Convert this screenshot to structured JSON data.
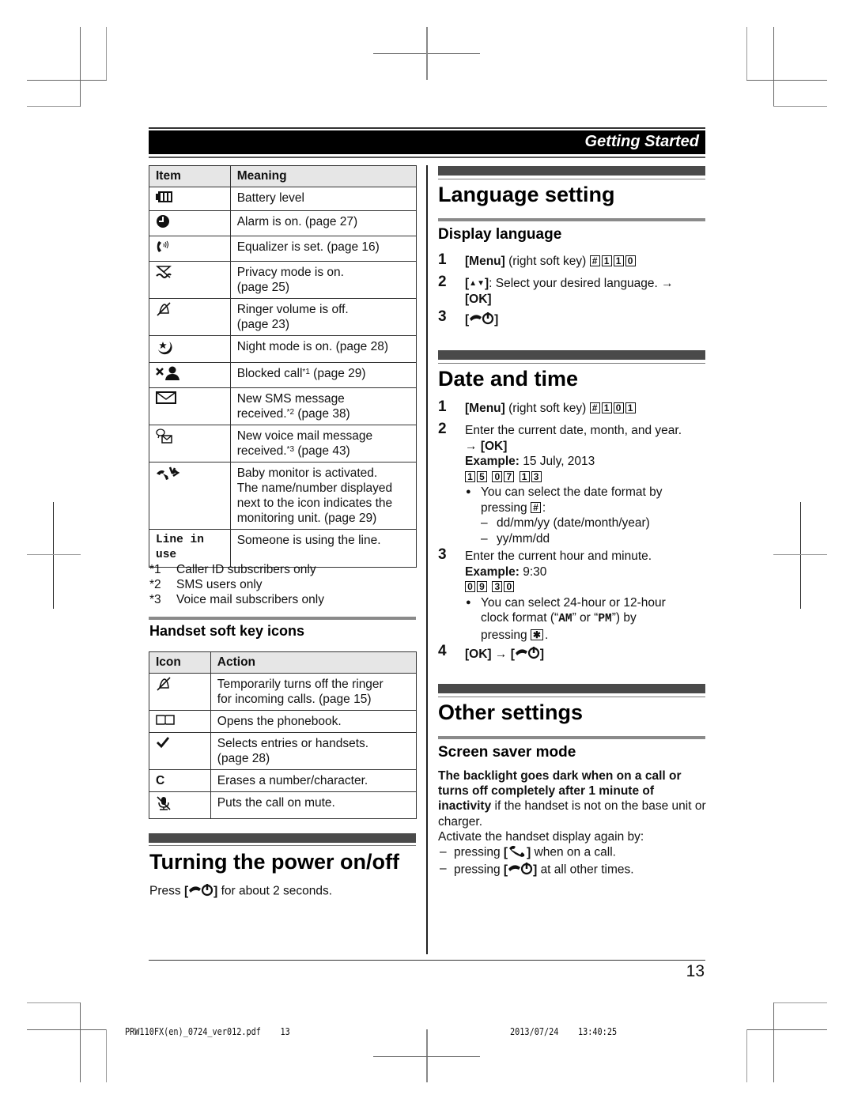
{
  "header": {
    "title": "Getting Started"
  },
  "display_icons_table": {
    "headers": [
      "Item",
      "Meaning"
    ],
    "rows": [
      {
        "icon": "battery-icon",
        "meaning": "Battery level"
      },
      {
        "icon": "alarm-clock-icon",
        "meaning": "Alarm is on. (page 27)"
      },
      {
        "icon": "equalizer-phone-icon",
        "meaning": "Equalizer is set. (page 16)"
      },
      {
        "icon": "privacy-mode-icon",
        "meaning_line1": "Privacy mode is on.",
        "meaning_line2": "(page 25)"
      },
      {
        "icon": "ringer-off-icon",
        "meaning_line1": "Ringer volume is off.",
        "meaning_line2": "(page 23)"
      },
      {
        "icon": "night-mode-icon",
        "meaning": "Night mode is on. (page 28)"
      },
      {
        "icon": "blocked-call-icon",
        "meaning_pre": "Blocked call",
        "sup": "*1",
        "meaning_post": " (page 29)"
      },
      {
        "icon": "sms-envelope-icon",
        "meaning_line1": "New SMS message",
        "meaning_pre": "received.",
        "sup": "*2",
        "meaning_post": " (page 38)"
      },
      {
        "icon": "voice-mail-icon",
        "meaning_line1": "New voice mail message",
        "meaning_pre": "received.",
        "sup": "*3",
        "meaning_post": " (page 43)"
      },
      {
        "icon": "baby-monitor-icon",
        "meaning_lines": [
          "Baby monitor is activated.",
          "The name/number displayed",
          "next to the icon indicates the",
          "monitoring unit. (page 29)"
        ]
      },
      {
        "icon_text_line1": "Line in",
        "icon_text_line2": "use",
        "meaning": "Someone is using the line."
      }
    ]
  },
  "footnotes": [
    {
      "mark": "*1",
      "text": "Caller ID subscribers only"
    },
    {
      "mark": "*2",
      "text": "SMS users only"
    },
    {
      "mark": "*3",
      "text": "Voice mail subscribers only"
    }
  ],
  "soft_keys": {
    "title": "Handset soft key icons",
    "headers": [
      "Icon",
      "Action"
    ],
    "rows": [
      {
        "icon": "ringer-off-icon",
        "line1": "Temporarily turns off the ringer",
        "line2": "for incoming calls. (page 15)"
      },
      {
        "icon": "phonebook-icon",
        "line1": "Opens the phonebook."
      },
      {
        "icon": "checkmark-icon",
        "line1": "Selects entries or handsets.",
        "line2": "(page 28)"
      },
      {
        "icon_text": "C",
        "line1": "Erases a number/character."
      },
      {
        "icon": "mute-icon",
        "line1": "Puts the call on mute."
      }
    ]
  },
  "power": {
    "title": "Turning the power on/off",
    "press": "Press",
    "after": "for about 2 seconds."
  },
  "language": {
    "title": "Language setting",
    "subtitle": "Display language",
    "steps": [
      {
        "num": "1",
        "menu": "Menu",
        "text": "(right soft key)",
        "keys": [
          "#",
          "1",
          "1",
          "0"
        ]
      },
      {
        "num": "2",
        "text": ": Select your desired language.",
        "arrow": "→",
        "ok": "OK"
      },
      {
        "num": "3"
      }
    ]
  },
  "date_time": {
    "title": "Date and time",
    "steps": [
      {
        "num": "1",
        "menu": "Menu",
        "text": "(right soft key)",
        "keys": [
          "#",
          "1",
          "0",
          "1"
        ]
      },
      {
        "num": "2",
        "text": "Enter the current date, month, and year.",
        "arrow": "→",
        "ok": "OK",
        "example_label": "Example:",
        "example_value": "15 July, 2013",
        "key_groups": [
          [
            "1",
            "5"
          ],
          [
            "0",
            "7"
          ],
          [
            "1",
            "3"
          ]
        ],
        "bullet_pre": "You can select the date format by",
        "bullet_post": "pressing",
        "bullet_key": "#",
        "formats": [
          "dd/mm/yy (date/month/year)",
          "yy/mm/dd"
        ]
      },
      {
        "num": "3",
        "text": "Enter the current hour and minute.",
        "example_label": "Example:",
        "example_value": "9:30",
        "key_groups": [
          [
            "0",
            "9"
          ],
          [
            "3",
            "0"
          ]
        ],
        "bullet_line1": "You can select 24-hour or 12-hour",
        "bullet_line2_pre": "clock format (“",
        "am": "AM",
        "mid": "” or “",
        "pm": "PM",
        "bullet_line2_post": "”) by",
        "bullet_line3": "pressing",
        "bullet_key": "✱"
      },
      {
        "num": "4",
        "ok": "OK",
        "arrow": "→"
      }
    ]
  },
  "other": {
    "title": "Other settings",
    "subtitle": "Screen saver mode",
    "bold_text": "The backlight goes dark when on a call or turns off completely after 1 minute of inactivity",
    "normal_text": " if the handset is not on the base unit or charger.",
    "activate": "Activate the handset display again by:",
    "pressing": "pressing",
    "item1_after": "when on a call.",
    "item2_after": "at all other times."
  },
  "footer": {
    "page_number": "13",
    "file_name": "PRW110FX(en)_0724_ver012.pdf",
    "file_page": "13",
    "print_date": "2013/07/24",
    "print_time": "13:40:25"
  }
}
